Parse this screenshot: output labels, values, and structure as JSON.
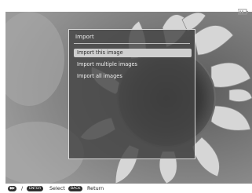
{
  "menu": {
    "title": "Import",
    "items": [
      {
        "label": "Import this image",
        "selected": true
      },
      {
        "label": "Import multiple images",
        "selected": false
      },
      {
        "label": "Import all images",
        "selected": false
      }
    ]
  },
  "guide": {
    "nav_symbol": "◆▶",
    "slash": "/",
    "enter_key": "ENTER",
    "select_label": "Select",
    "back_key": "BACK",
    "return_label": "Return"
  },
  "icons": {
    "top_right": "battery-indicator-icon",
    "nav": "direction-buttons-icon"
  },
  "colors": {
    "menu_bg": "#464646",
    "selected_bg": "#cfcfcf",
    "guide_pill": "#2f2f2f"
  }
}
